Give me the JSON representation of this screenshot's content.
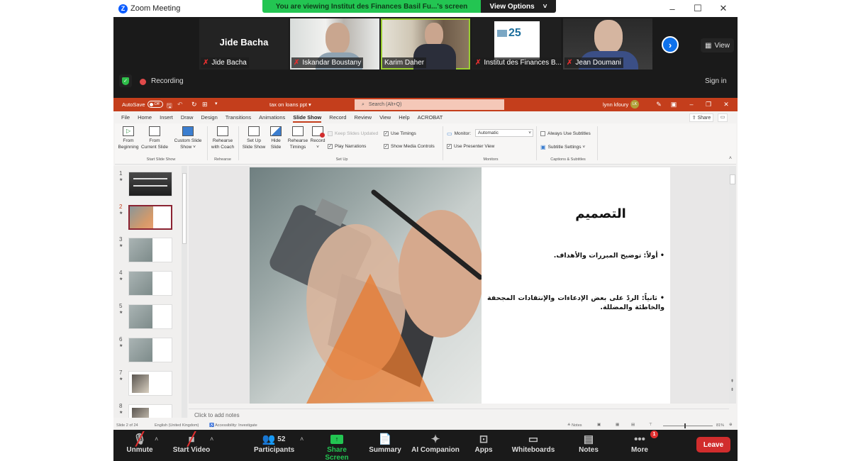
{
  "window": {
    "app_title": "Zoom Meeting",
    "viewing_banner": "You are viewing Institut des Finances Basil Fu...'s screen",
    "view_options_label": "View Options",
    "controls": {
      "minimize": "–",
      "maximize": "☐",
      "close": "✕"
    }
  },
  "gallery": {
    "participants": [
      {
        "name": "Jide Bacha",
        "display_name": "Jide Bacha",
        "muted": true,
        "video": false
      },
      {
        "name": "Iskandar Boustany",
        "muted": true,
        "video": true
      },
      {
        "name": "Karim Daher",
        "muted": false,
        "video": true,
        "active_speaker": true
      },
      {
        "name": "Institut des Finances B...",
        "muted": true,
        "video": true
      },
      {
        "name": "Jean Doumani",
        "muted": true,
        "video": true
      }
    ],
    "next_icon": "›",
    "view_label": "View"
  },
  "status": {
    "recording_label": "Recording",
    "sign_in_label": "Sign in"
  },
  "powerpoint": {
    "autosave_label": "AutoSave",
    "autosave_state": "Off",
    "doc_title": "tax on loans ppt",
    "search_placeholder": "Search (Alt+Q)",
    "user_name": "lynn kfoury",
    "user_initials": "LK",
    "menu": [
      "File",
      "Home",
      "Insert",
      "Draw",
      "Design",
      "Transitions",
      "Animations",
      "Slide Show",
      "Record",
      "Review",
      "View",
      "Help",
      "ACROBAT"
    ],
    "active_menu": "Slide Show",
    "share_label": "Share",
    "ribbon": {
      "start_group": {
        "label": "Start Slide Show",
        "buttons": [
          {
            "line1": "From",
            "line2": "Beginning"
          },
          {
            "line1": "From",
            "line2": "Current Slide"
          },
          {
            "line1": "Custom Slide",
            "line2": "Show ˅"
          }
        ]
      },
      "rehearse_group": {
        "label": "Rehearse",
        "buttons": [
          {
            "line1": "Rehearse",
            "line2": "with Coach"
          }
        ]
      },
      "setup_group": {
        "label": "Set Up",
        "buttons": [
          {
            "line1": "Set Up",
            "line2": "Slide Show"
          },
          {
            "line1": "Hide",
            "line2": "Slide"
          },
          {
            "line1": "Rehearse",
            "line2": "Timings"
          },
          {
            "line1": "Record",
            "line2": "˅"
          }
        ],
        "checks": [
          {
            "label": "Keep Slides Updated",
            "checked": false,
            "disabled": true
          },
          {
            "label": "Use Timings",
            "checked": true
          },
          {
            "label": "Play Narrations",
            "checked": true
          },
          {
            "label": "Show Media Controls",
            "checked": true
          }
        ]
      },
      "monitors_group": {
        "label": "Monitors",
        "monitor_label": "Monitor:",
        "monitor_value": "Automatic",
        "presenter_view": {
          "label": "Use Presenter View",
          "checked": true
        }
      },
      "captions_group": {
        "label": "Captions & Subtitles",
        "always_subtitles": {
          "label": "Always Use Subtitles",
          "checked": false
        },
        "subtitle_settings": "Subtitle Settings ˅"
      }
    },
    "thumbnails": [
      1,
      2,
      3,
      4,
      5,
      6,
      7,
      8
    ],
    "current_slide": 2,
    "slide": {
      "title": "التصميم",
      "bullets": [
        "أولاً: توضيح المبررات والأهداف.",
        "ثانياً: الردّ على بعض الإدعاءات والإنتقادات المجحفة والخاطئة والمضللة."
      ]
    },
    "notes_placeholder": "Click to add notes",
    "statusbar": {
      "slide_info": "Slide 2 of 24",
      "language": "English (United Kingdom)",
      "accessibility": "Accessibility: Investigate",
      "notes_label": "Notes",
      "zoom": "81%"
    }
  },
  "toolbar": {
    "unmute": "Unmute",
    "start_video": "Start Video",
    "participants": "Participants",
    "participants_count": "52",
    "share_screen": "Share Screen",
    "summary": "Summary",
    "ai_companion": "AI Companion",
    "apps": "Apps",
    "whiteboards": "Whiteboards",
    "notes": "Notes",
    "more": "More",
    "more_badge": "1",
    "leave": "Leave"
  },
  "colors": {
    "zoom_green": "#23c552",
    "zoom_blue": "#0e71eb",
    "ppt_red": "#c43e1c",
    "leave_red": "#d12d2d",
    "selected_thumb": "#8b2332"
  }
}
